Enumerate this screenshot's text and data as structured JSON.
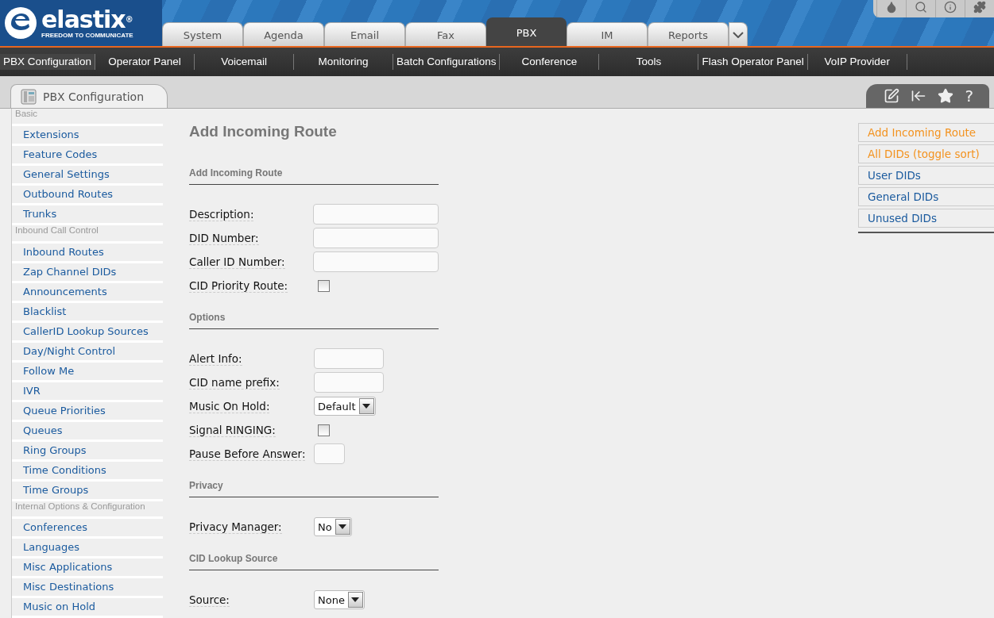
{
  "logo": {
    "name": "elastix",
    "mark": "®",
    "tagline": "FREEDOM TO COMMUNICATE"
  },
  "main_tabs": [
    {
      "label": "System",
      "selected": false
    },
    {
      "label": "Agenda",
      "selected": false
    },
    {
      "label": "Email",
      "selected": false
    },
    {
      "label": "Fax",
      "selected": false
    },
    {
      "label": "PBX",
      "selected": true
    },
    {
      "label": "IM",
      "selected": false
    },
    {
      "label": "Reports",
      "selected": false
    }
  ],
  "sub_menu": [
    {
      "label": "PBX Configuration",
      "selected": true
    },
    {
      "label": "Operator Panel",
      "selected": false
    },
    {
      "label": "Voicemail",
      "selected": false
    },
    {
      "label": "Monitoring",
      "selected": false
    },
    {
      "label": "Batch Configurations",
      "selected": false
    },
    {
      "label": "Conference",
      "selected": false
    },
    {
      "label": "Tools",
      "selected": false
    },
    {
      "label": "Flash Operator Panel",
      "selected": false
    },
    {
      "label": "VoIP Provider",
      "selected": false
    }
  ],
  "module_tab": {
    "title": "PBX Configuration",
    "help": "?"
  },
  "sidebar": [
    {
      "kind": "heading",
      "label": "Basic"
    },
    {
      "kind": "link",
      "label": "Extensions"
    },
    {
      "kind": "link",
      "label": "Feature Codes"
    },
    {
      "kind": "link",
      "label": "General Settings"
    },
    {
      "kind": "link",
      "label": "Outbound Routes"
    },
    {
      "kind": "link",
      "label": "Trunks"
    },
    {
      "kind": "heading",
      "label": "Inbound Call Control"
    },
    {
      "kind": "link",
      "label": "Inbound Routes"
    },
    {
      "kind": "link",
      "label": "Zap Channel DIDs"
    },
    {
      "kind": "link",
      "label": "Announcements"
    },
    {
      "kind": "link",
      "label": "Blacklist"
    },
    {
      "kind": "link",
      "label": "CallerID Lookup Sources"
    },
    {
      "kind": "link",
      "label": "Day/Night Control"
    },
    {
      "kind": "link",
      "label": "Follow Me"
    },
    {
      "kind": "link",
      "label": "IVR"
    },
    {
      "kind": "link",
      "label": "Queue Priorities"
    },
    {
      "kind": "link",
      "label": "Queues"
    },
    {
      "kind": "link",
      "label": "Ring Groups"
    },
    {
      "kind": "link",
      "label": "Time Conditions"
    },
    {
      "kind": "link",
      "label": "Time Groups"
    },
    {
      "kind": "heading",
      "label": "Internal Options & Configuration"
    },
    {
      "kind": "link",
      "label": "Conferences"
    },
    {
      "kind": "link",
      "label": "Languages"
    },
    {
      "kind": "link",
      "label": "Misc Applications"
    },
    {
      "kind": "link",
      "label": "Misc Destinations"
    },
    {
      "kind": "link",
      "label": "Music on Hold"
    }
  ],
  "form": {
    "title": "Add Incoming Route",
    "sections": [
      {
        "title": "Add Incoming Route",
        "fields": [
          {
            "kind": "text",
            "label": "Description:"
          },
          {
            "kind": "text",
            "label": "DID Number:"
          },
          {
            "kind": "text",
            "label": "Caller ID Number:"
          },
          {
            "kind": "checkbox",
            "label": "CID Priority Route:",
            "checked": false
          }
        ]
      },
      {
        "title": "Options",
        "fields": [
          {
            "kind": "shorttext",
            "label": "Alert Info:"
          },
          {
            "kind": "shorttext",
            "label": "CID name prefix:"
          },
          {
            "kind": "select",
            "label": "Music On Hold:",
            "value": "Default"
          },
          {
            "kind": "checkbox",
            "label": "Signal RINGING:",
            "checked": false
          },
          {
            "kind": "tinytext",
            "label": "Pause Before Answer:"
          }
        ]
      },
      {
        "title": "Privacy",
        "fields": [
          {
            "kind": "select",
            "label": "Privacy Manager:",
            "value": "No"
          }
        ]
      },
      {
        "title": "CID Lookup Source",
        "fields": [
          {
            "kind": "select",
            "label": "Source:",
            "value": "None"
          }
        ]
      }
    ]
  },
  "right_menu": [
    {
      "label": "Add Incoming Route",
      "active": true
    },
    {
      "label": "All DIDs (toggle sort)",
      "active": true
    },
    {
      "label": "User DIDs",
      "active": false
    },
    {
      "label": "General DIDs",
      "active": false
    },
    {
      "label": "Unused DIDs",
      "active": false
    }
  ]
}
